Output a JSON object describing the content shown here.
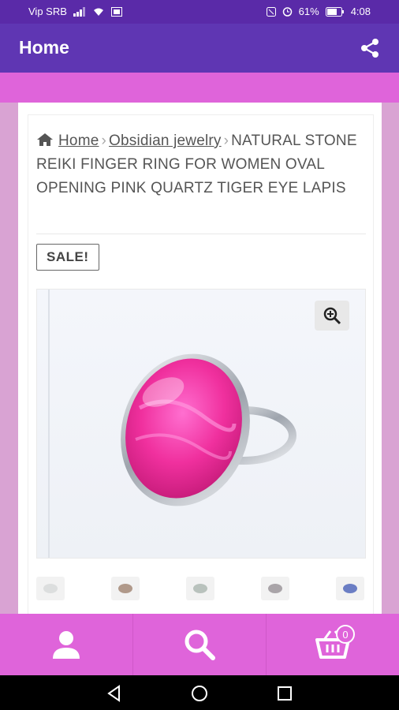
{
  "status_bar": {
    "carrier": "Vip SRB",
    "battery": "61%",
    "time": "4:08"
  },
  "app_bar": {
    "title": "Home"
  },
  "breadcrumb": {
    "home": "Home",
    "category": "Obsidian jewelry",
    "separator": "›",
    "current": "NATURAL STONE REIKI FINGER RING FOR WOMEN OVAL OPENING PINK QUARTZ TIGER EYE LAPIS"
  },
  "product": {
    "sale_badge": "SALE!"
  },
  "thumbnails": [
    {
      "color": "#dcdede"
    },
    {
      "color": "#b0998a"
    },
    {
      "color": "#b9c2bd"
    },
    {
      "color": "#a9a4a8"
    },
    {
      "color": "#6b7ec4"
    }
  ],
  "bottom_nav": {
    "cart_count": "0"
  },
  "icons": [
    "home-icon",
    "share-icon",
    "zoom-in-icon",
    "user-icon",
    "search-icon",
    "cart-icon",
    "back-icon",
    "home-circle-icon",
    "recent-apps-icon"
  ]
}
